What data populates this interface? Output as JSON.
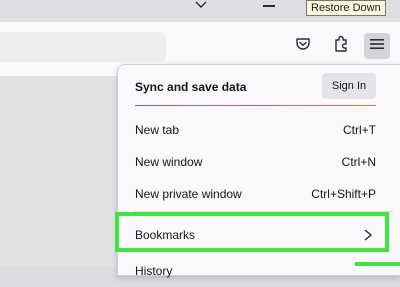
{
  "tooltip": {
    "text": "Restore Down"
  },
  "icons": {
    "tab_list": "chevron-down-icon",
    "minimize": "minimize-icon",
    "pocket": "pocket-icon",
    "extensions": "puzzle-piece-icon",
    "app_menu": "hamburger-menu-icon",
    "submenu": "chevron-right-icon"
  },
  "menu": {
    "sync": {
      "title": "Sync and save data",
      "button": "Sign In"
    },
    "items": [
      {
        "label": "New tab",
        "shortcut": "Ctrl+T"
      },
      {
        "label": "New window",
        "shortcut": "Ctrl+N"
      },
      {
        "label": "New private window",
        "shortcut": "Ctrl+Shift+P"
      },
      {
        "label": "Bookmarks",
        "shortcut": ""
      },
      {
        "label": "History",
        "shortcut": ""
      }
    ]
  },
  "colors": {
    "highlight": "#3fe63f",
    "panel_bg": "#f9f9fb",
    "sign_in_bg": "#e3e3e8",
    "sync_gradient": [
      "#6f66d8",
      "#c45a8c",
      "#e87c3f"
    ]
  }
}
